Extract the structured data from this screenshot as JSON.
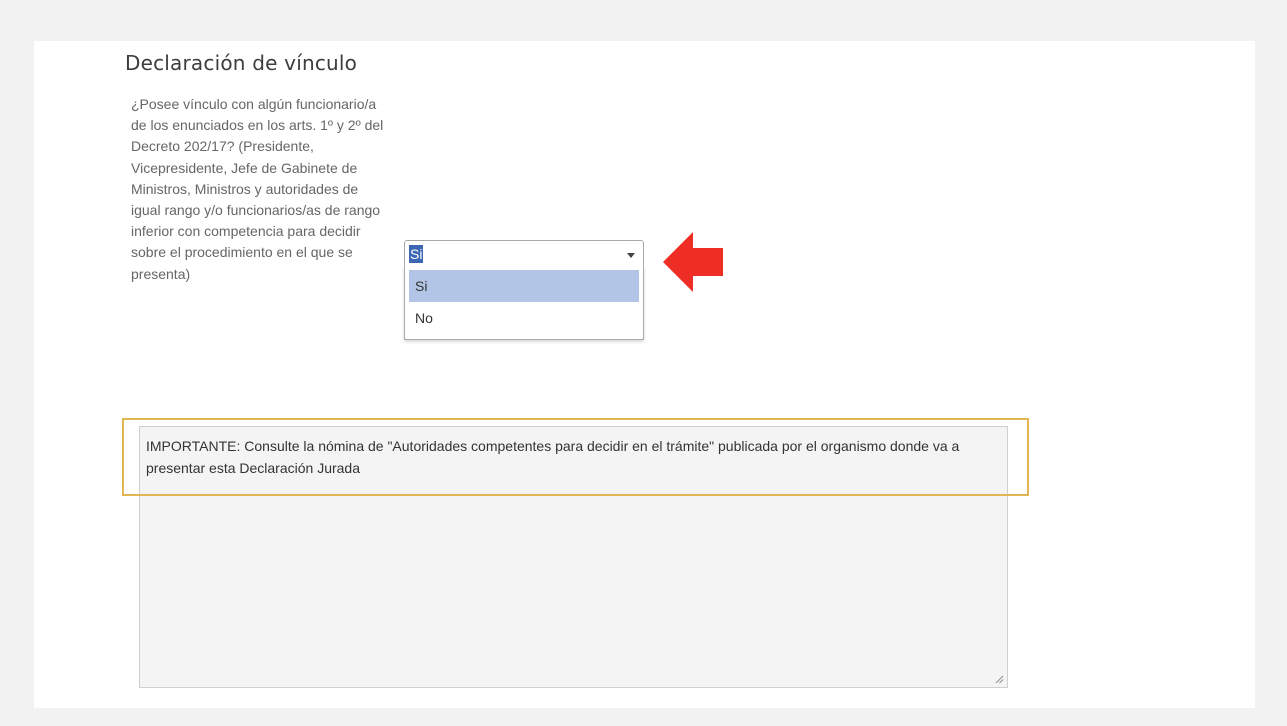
{
  "section": {
    "title": "Declaración de vínculo"
  },
  "question": {
    "text": "¿Posee vínculo con algún funcionario/a de los enunciados en los arts. 1º y 2º del Decreto 202/17? (Presidente, Vicepresidente, Jefe de Gabinete de Ministros, Ministros y autoridades de igual rango y/o funcionarios/as de rango inferior con competencia para decidir sobre el procedimiento en el que se presenta)"
  },
  "select": {
    "selected_value": "Si",
    "options": [
      {
        "label": "Si",
        "highlighted": true
      },
      {
        "label": "No",
        "highlighted": false
      }
    ]
  },
  "textarea": {
    "value": "IMPORTANTE: Consulte la nómina de \"Autoridades competentes para decidir en el trámite\" publicada por el organismo donde va a presentar esta Declaración Jurada"
  },
  "annotations": {
    "arrow_icon": "left-arrow-icon",
    "arrow_color": "#ee2e24",
    "highlight_color": "#e2b553"
  },
  "colors": {
    "page_background": "#f2f2f2",
    "panel_background": "#ffffff",
    "selection_background": "#3c67b5",
    "option_highlight": "#b3c5e6",
    "textarea_background": "#f4f4f4"
  }
}
